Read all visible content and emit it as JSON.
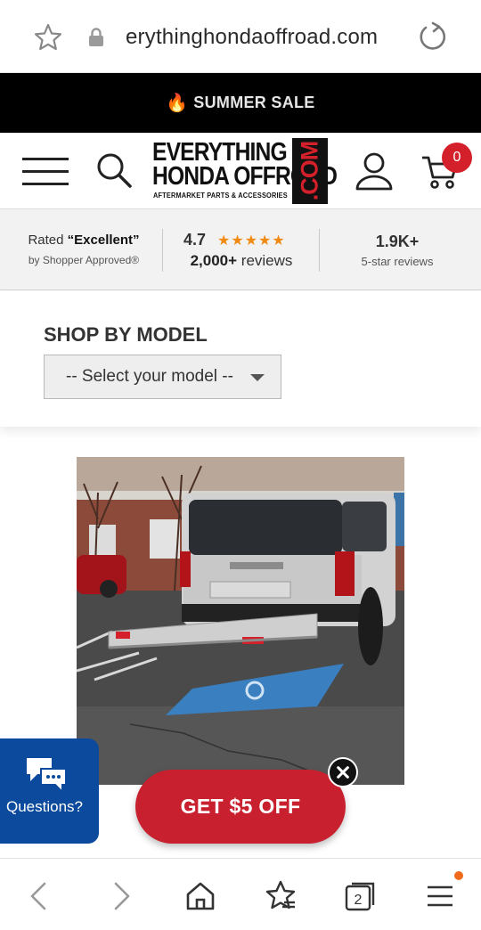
{
  "browser": {
    "url": "erythinghondaoffroad.com"
  },
  "banner": {
    "icon": "fire-icon",
    "text": "SUMMER SALE"
  },
  "header": {
    "logo_line1": "EVERYTHING",
    "logo_line2": "HONDA OFFROAD",
    "logo_tagline": "AFTERMARKET PARTS & ACCESSORIES",
    "logo_com": ".COM",
    "cart_count": "0"
  },
  "ratings": {
    "rated_prefix": "Rated ",
    "rated_value": "“Excellent”",
    "by_line": "by Shopper Approved®",
    "score": "4.7",
    "stars": "★★★★★",
    "reviews_count": "2,000+",
    "reviews_word": " reviews",
    "five_star_count": "1.9K+",
    "five_star_label": "5-star reviews"
  },
  "shop_by_model": {
    "title": "SHOP BY MODEL",
    "select_value": "-- Select your model --"
  },
  "chat": {
    "label": "Questions?"
  },
  "promo": {
    "label": "GET $5 OFF"
  },
  "colors": {
    "banner_bg": "#000000",
    "brand_red": "#d4202a",
    "promo_red": "#c8202e",
    "chat_blue": "#0b4a9c",
    "star_orange": "#f08a12"
  }
}
